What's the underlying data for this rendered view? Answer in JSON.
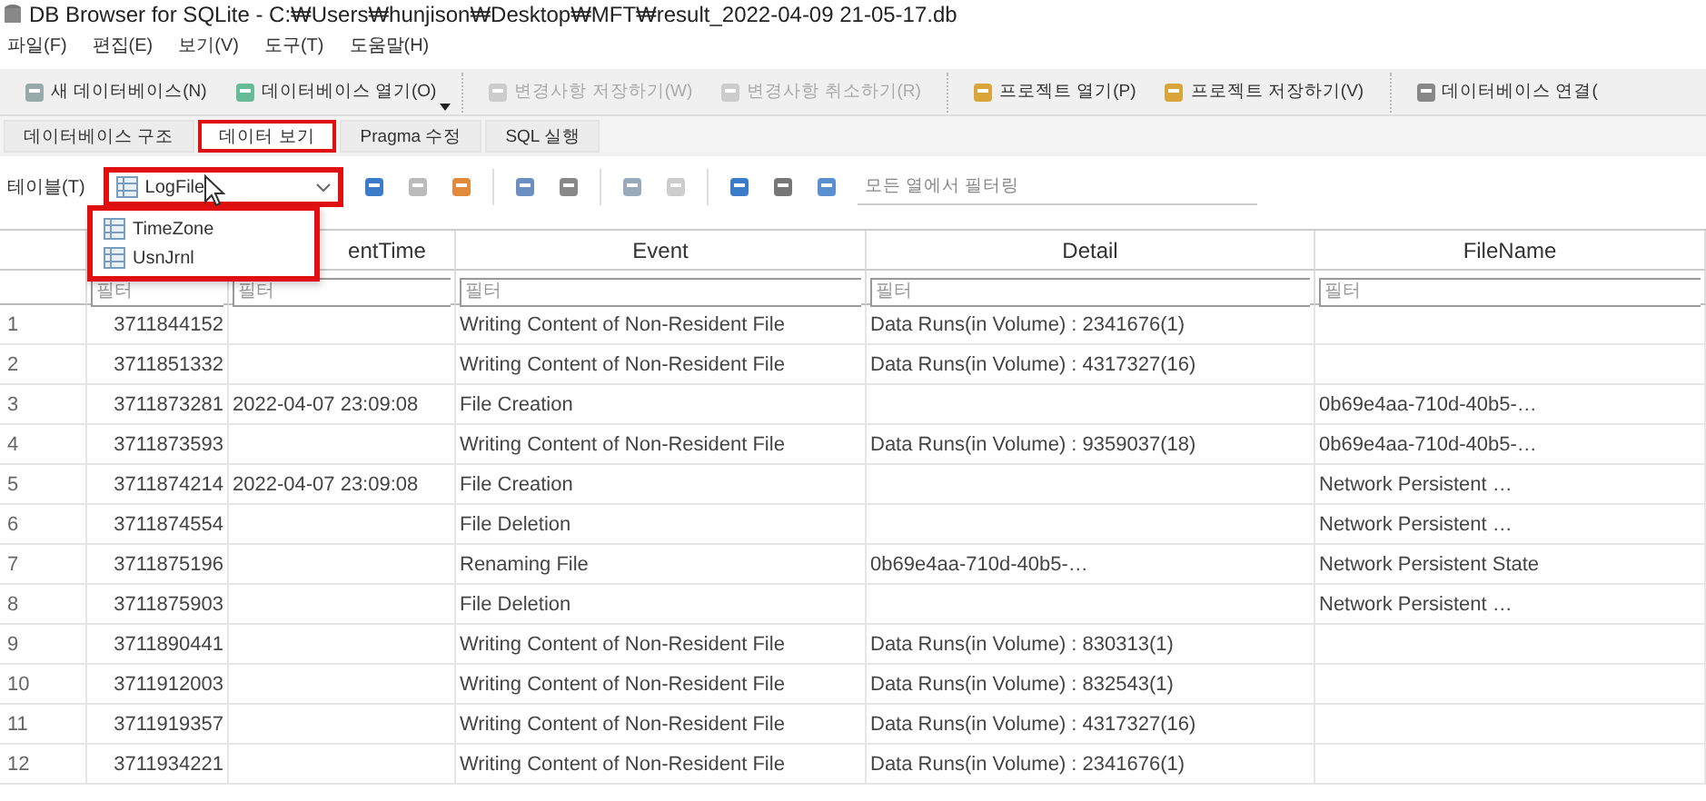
{
  "window": {
    "title": "DB Browser for SQLite - C:₩Users₩hunjison₩Desktop₩MFT₩result_2022-04-09 21-05-17.db"
  },
  "menu": [
    "파일(F)",
    "편집(E)",
    "보기(V)",
    "도구(T)",
    "도움말(H)"
  ],
  "toolbar": [
    {
      "label": "새 데이터베이스(N)",
      "disabled": false
    },
    {
      "label": "데이터베이스 열기(O)",
      "disabled": false
    },
    {
      "label": "변경사항 저장하기(W)",
      "disabled": true
    },
    {
      "label": "변경사항 취소하기(R)",
      "disabled": true
    },
    {
      "label": "프로젝트 열기(P)",
      "disabled": false
    },
    {
      "label": "프로젝트 저장하기(V)",
      "disabled": false
    },
    {
      "label": "데이터베이스 연결(",
      "disabled": false
    }
  ],
  "tabs": [
    {
      "label": "데이터베이스 구조",
      "selected": false,
      "highlighted": false
    },
    {
      "label": "데이터 보기",
      "selected": true,
      "highlighted": true
    },
    {
      "label": "Pragma 수정",
      "selected": false,
      "highlighted": false
    },
    {
      "label": "SQL 실행",
      "selected": false,
      "highlighted": false
    }
  ],
  "table_selector": {
    "label": "테이블(T)",
    "value": "LogFile",
    "expanded": true,
    "highlighted": true,
    "options": [
      "TimeZone",
      "UsnJrnl"
    ]
  },
  "filter_all": {
    "placeholder": "모든 열에서 필터링"
  },
  "table": {
    "columns": [
      "",
      "entTime",
      "Event",
      "Detail",
      "FileName"
    ],
    "filters": [
      {
        "placeholder": "필터"
      },
      {
        "placeholder": "필터"
      },
      {
        "placeholder": "필터"
      },
      {
        "placeholder": "필터"
      },
      {
        "placeholder": "필터"
      }
    ],
    "rows": [
      {
        "n": "1",
        "cells": [
          "3711844152",
          "",
          "Writing Content of Non-Resident File",
          "Data Runs(in Volume) : 2341676(1)",
          ""
        ]
      },
      {
        "n": "2",
        "cells": [
          "3711851332",
          "",
          "Writing Content of Non-Resident File",
          "Data Runs(in Volume) : 4317327(16)",
          ""
        ]
      },
      {
        "n": "3",
        "cells": [
          "3711873281",
          "2022-04-07 23:09:08",
          "File Creation",
          "",
          "0b69e4aa-710d-40b5-…"
        ]
      },
      {
        "n": "4",
        "cells": [
          "3711873593",
          "",
          "Writing Content of Non-Resident File",
          "Data Runs(in Volume) : 9359037(18)",
          "0b69e4aa-710d-40b5-…"
        ]
      },
      {
        "n": "5",
        "cells": [
          "3711874214",
          "2022-04-07 23:09:08",
          "File Creation",
          "",
          "Network Persistent …"
        ]
      },
      {
        "n": "6",
        "cells": [
          "3711874554",
          "",
          "File Deletion",
          "",
          "Network Persistent …"
        ]
      },
      {
        "n": "7",
        "cells": [
          "3711875196",
          "",
          "Renaming File",
          "0b69e4aa-710d-40b5-…",
          "Network Persistent State"
        ]
      },
      {
        "n": "8",
        "cells": [
          "3711875903",
          "",
          "File Deletion",
          "",
          "Network Persistent …"
        ]
      },
      {
        "n": "9",
        "cells": [
          "3711890441",
          "",
          "Writing Content of Non-Resident File",
          "Data Runs(in Volume) : 830313(1)",
          ""
        ]
      },
      {
        "n": "10",
        "cells": [
          "3711912003",
          "",
          "Writing Content of Non-Resident File",
          "Data Runs(in Volume) : 832543(1)",
          ""
        ]
      },
      {
        "n": "11",
        "cells": [
          "3711919357",
          "",
          "Writing Content of Non-Resident File",
          "Data Runs(in Volume) : 4317327(16)",
          ""
        ]
      },
      {
        "n": "12",
        "cells": [
          "3711934221",
          "",
          "Writing Content of Non-Resident File",
          "Data Runs(in Volume) : 2341676(1)",
          ""
        ]
      }
    ]
  }
}
